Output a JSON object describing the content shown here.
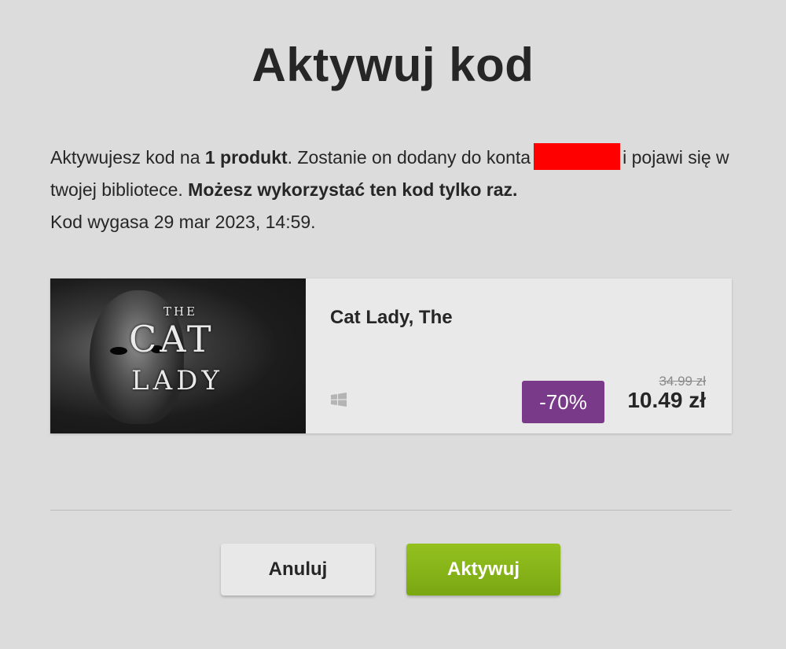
{
  "dialog": {
    "title": "Aktywuj kod",
    "description": {
      "part1": "Aktywujesz kod na ",
      "product_count": "1 produkt",
      "part2": ". Zostanie on dodany do konta",
      "part3": "i pojawi się w twojej bibliotece. ",
      "warning": "Możesz wykorzystać ten kod tylko raz.",
      "expiry": "Kod wygasa 29 mar 2023, 14:59."
    },
    "product": {
      "name": "Cat Lady, The",
      "cover_text": {
        "line1": "THE",
        "line2": "CAT",
        "line3": "LADY"
      },
      "platform_icon": "windows-icon",
      "discount": "-70%",
      "price_old": "34.99 zł",
      "price_new": "10.49 zł"
    },
    "buttons": {
      "cancel_label": "Anuluj",
      "activate_label": "Aktywuj"
    }
  },
  "colors": {
    "background": "#dcdcdc",
    "discount_badge": "#7a3a8a",
    "activate_button": "#8ab51a",
    "redaction": "#ff0000"
  }
}
